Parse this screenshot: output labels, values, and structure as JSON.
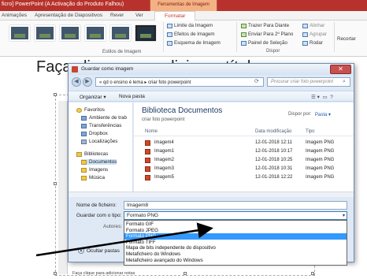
{
  "app": {
    "title": "ficro] PowerPoint (A Activação do Produto Falhou)",
    "context_tab_group": "Ferramentas de Imagem",
    "ribbon_tabs": [
      "Animações",
      "Apresentação de Diapositivos",
      "Rever",
      "Ver"
    ],
    "active_tab": "Formatar",
    "picture_styles_label": "Estilos de Imagem",
    "picture_buttons": [
      "Limite da Imagem",
      "Efeitos de Imagem",
      "Esquema de Imagem"
    ],
    "arrange_buttons": [
      "Trazer Para Diante",
      "Enviar Para 2º Plano",
      "Painel de Seleção"
    ],
    "align_buttons": [
      "Alinhar",
      "Agrupar",
      "Rodar"
    ],
    "arrange_group_label": "Dispor",
    "crop_label": "Recortar",
    "slide_title": "Faça clique para adicionar título",
    "slide_footer": "Faça clique para adicionar notas"
  },
  "dialog": {
    "title": "Guardar como imagem",
    "address": "« qd o ensino é lema ▸ criar foto powerpoint",
    "search_placeholder": "Procurar criar foto powerpoint",
    "toolbar": {
      "organize": "Organizar ▾",
      "new_folder": "Nova pasta"
    },
    "nav": [
      {
        "label": "Favoritos",
        "icon": "star-icon"
      },
      {
        "label": "Ambiente de trab",
        "icon": "desktop-icon"
      },
      {
        "label": "Transferências",
        "icon": "downloads-icon"
      },
      {
        "label": "Dropbox",
        "icon": "dropbox-icon"
      },
      {
        "label": "Localizações",
        "icon": "places-icon"
      },
      {
        "label": "Bibliotecas",
        "icon": "libraries-icon"
      },
      {
        "label": "Documentos",
        "icon": "documents-icon"
      },
      {
        "label": "Imagens",
        "icon": "pictures-icon"
      },
      {
        "label": "Música",
        "icon": "music-icon"
      }
    ],
    "library_title": "Biblioteca Documentos",
    "library_subtitle": "criar foto powerpoint",
    "arrange_label": "Dispor por:",
    "arrange_value": "Pasta ▾",
    "columns": [
      "Nome",
      "Data modificação",
      "Tipo"
    ],
    "files": [
      {
        "name": "imagem4",
        "date": "12-01-2018 12:11",
        "type": "Imagem PNG"
      },
      {
        "name": "Imagem1",
        "date": "12-01-2018 10:17",
        "type": "Imagem PNG"
      },
      {
        "name": "Imagem2",
        "date": "12-01-2018 10:25",
        "type": "Imagem PNG"
      },
      {
        "name": "Imagem3",
        "date": "12-01-2018 10:31",
        "type": "Imagem PNG"
      },
      {
        "name": "Imagem5",
        "date": "12-01-2018 12:22",
        "type": "Imagem PNG"
      }
    ],
    "filename_label": "Nome de ficheiro:",
    "filename_value": "Imagem8",
    "filetype_label": "Guardar com o tipo:",
    "filetype_value": "Formato PNG",
    "authors_label": "Autores:",
    "filetype_options": [
      "Formato GIF",
      "Formato JPEG",
      "Formato PNG",
      "Formato TIFF",
      "Mapa de bits independente do dispositivo",
      "Metaficheiro do Windows",
      "Metaficheiro avançado do Windows"
    ],
    "selected_option_index": 2,
    "hide_folders": "Ocultar pastas"
  },
  "colors": {
    "titlebar": "#b7322c",
    "selection": "#3399ff",
    "library_title": "#1e3a66"
  }
}
